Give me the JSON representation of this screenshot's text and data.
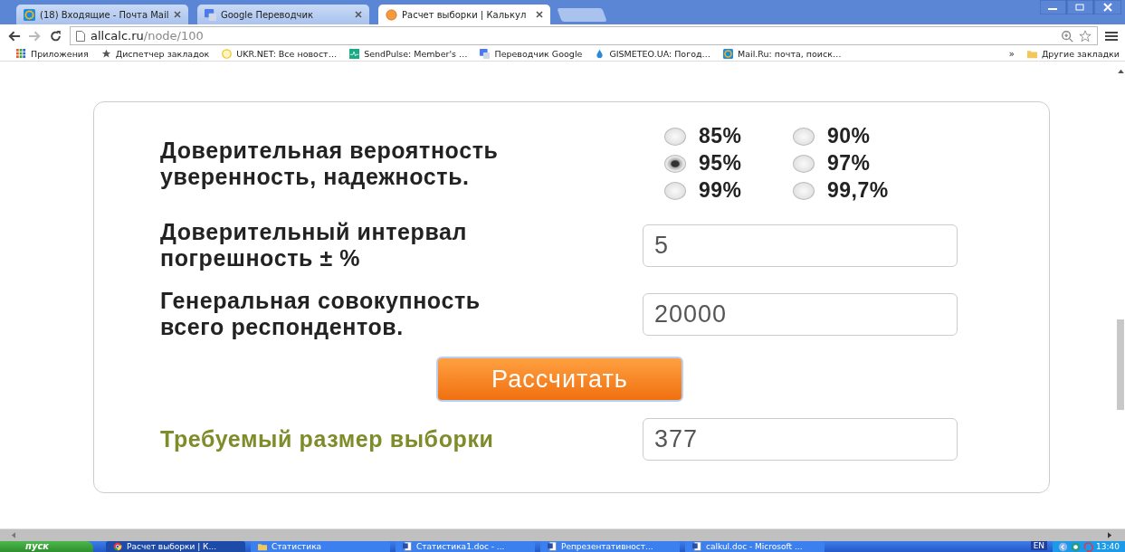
{
  "browser": {
    "tabs": [
      {
        "title": "(18) Входящие - Почта Mail",
        "kind": "mail",
        "selected": false
      },
      {
        "title": "Google Переводчик",
        "kind": "translate",
        "selected": false
      },
      {
        "title": "Расчет выборки | Калькул",
        "kind": "site",
        "selected": true
      }
    ],
    "url": {
      "host": "allcalc.ru",
      "path": "/node/100"
    },
    "bookmarks": [
      {
        "title": "Приложения",
        "kind": "apps"
      },
      {
        "title": "Диспетчер закладок",
        "kind": "star"
      },
      {
        "title": "UKR.NET: Все новост…",
        "kind": "ukr"
      },
      {
        "title": "SendPulse: Member's …",
        "kind": "pulse"
      },
      {
        "title": "Переводчик Google",
        "kind": "translate"
      },
      {
        "title": "GISMETEO.UA: Погод…",
        "kind": "drop"
      },
      {
        "title": "Mail.Ru: почта, поиск…",
        "kind": "mail"
      }
    ],
    "overflow": "»",
    "other_bookmarks": "Другие закладки"
  },
  "form": {
    "confidence": {
      "lines": [
        "Доверительная вероятность",
        "уверенность, надежность."
      ],
      "options": [
        {
          "label": "85%",
          "selected": false
        },
        {
          "label": "90%",
          "selected": false
        },
        {
          "label": "95%",
          "selected": true
        },
        {
          "label": "97%",
          "selected": false
        },
        {
          "label": "99%",
          "selected": false
        },
        {
          "label": "99,7%",
          "selected": false
        }
      ]
    },
    "interval": {
      "lines": [
        "Доверительный интервал",
        "погрешность ± %"
      ],
      "value": "5"
    },
    "population": {
      "lines": [
        "Генеральная совокупность",
        "всего респондентов."
      ],
      "value": "20000"
    },
    "button": "Рассчитать",
    "result": {
      "label": "Требуемый размер выборки",
      "value": "377"
    }
  },
  "taskbar": {
    "start": "пуск",
    "tasks": [
      {
        "title": "Расчет выборки | К...",
        "kind": "chrome",
        "selected": true
      },
      {
        "title": "Статистика",
        "kind": "folder",
        "selected": false
      },
      {
        "title": "Статистика1.doc - ...",
        "kind": "word",
        "selected": false
      },
      {
        "title": "Репрезентативност...",
        "kind": "word",
        "selected": false
      },
      {
        "title": "calkul.doc - Microsoft ...",
        "kind": "word",
        "selected": false
      }
    ],
    "lang": "EN",
    "clock": "13:40"
  }
}
